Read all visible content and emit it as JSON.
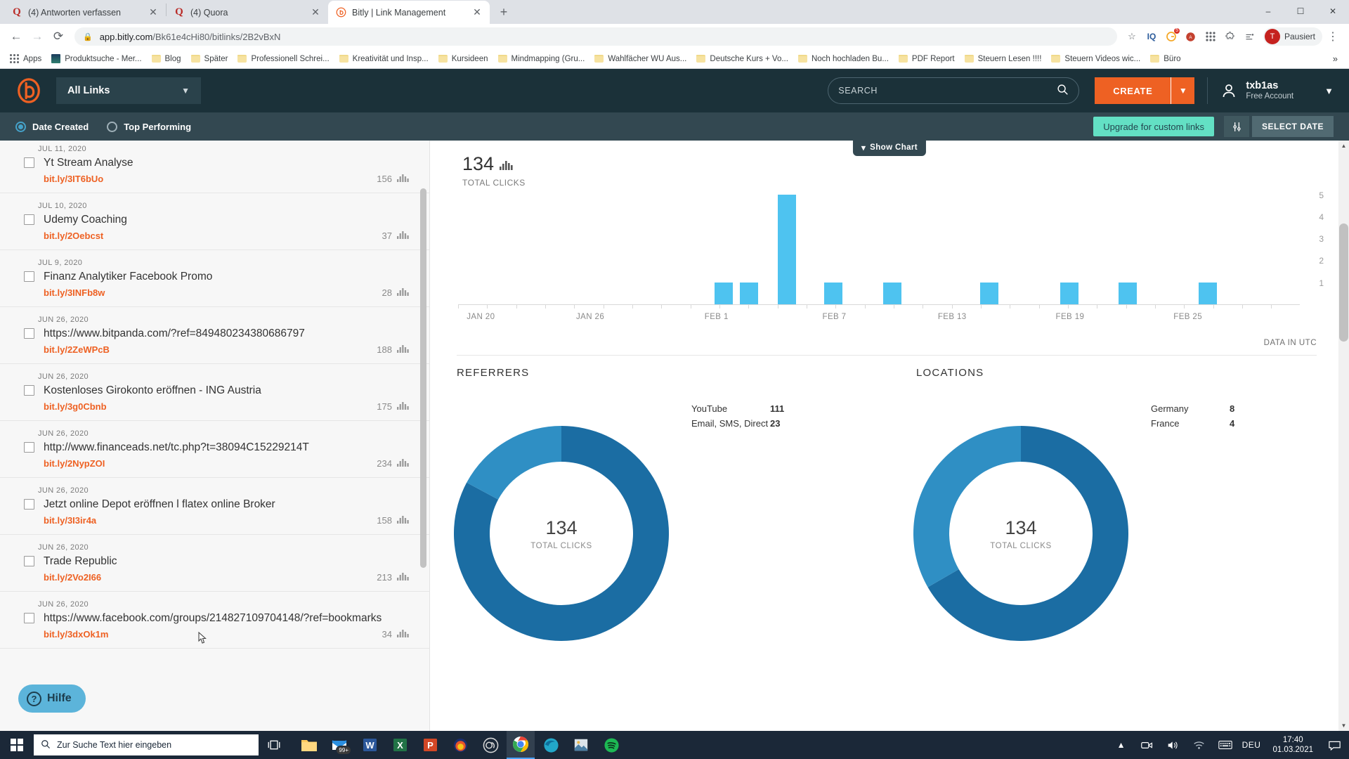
{
  "browser": {
    "tabs": [
      {
        "title": "(4) Antworten verfassen",
        "favicon": "quora-icon",
        "active": false
      },
      {
        "title": "(4) Quora",
        "favicon": "quora-icon",
        "active": false
      },
      {
        "title": "Bitly | Link Management",
        "favicon": "bitly-icon",
        "active": true
      }
    ],
    "new_tab_label": "+",
    "window_controls": {
      "minimize": "–",
      "maximize": "☐",
      "close": "✕"
    },
    "nav": {
      "back": "←",
      "forward": "→",
      "reload": "⟳"
    },
    "omnibox": {
      "lock_icon": "lock-icon",
      "url_host": "app.bitly.com",
      "url_path": "/Bk61e4cHi80/bitlinks/2B2vBxN",
      "star_icon": "bookmark-star-icon"
    },
    "toolbar_icons": [
      "iq-extension-icon",
      "extension-puzzle-icon",
      "grammarly-icon",
      "apps-grid-icon",
      "extensions-icon",
      "list-icon"
    ],
    "profile": {
      "initial": "T",
      "label": "Pausiert"
    },
    "bookmarks": [
      {
        "label": "Apps",
        "icon": "apps-grid-icon"
      },
      {
        "label": "Produktsuche - Mer...",
        "icon": "site-favicon"
      },
      {
        "label": "Blog",
        "icon": "folder-icon"
      },
      {
        "label": "Später",
        "icon": "folder-icon"
      },
      {
        "label": "Professionell Schrei...",
        "icon": "folder-icon"
      },
      {
        "label": "Kreativität und Insp...",
        "icon": "folder-icon"
      },
      {
        "label": "Kursideen",
        "icon": "folder-icon"
      },
      {
        "label": "Mindmapping  (Gru...",
        "icon": "folder-icon"
      },
      {
        "label": "Wahlfächer WU Aus...",
        "icon": "folder-icon"
      },
      {
        "label": "Deutsche Kurs + Vo...",
        "icon": "folder-icon"
      },
      {
        "label": "Noch hochladen Bu...",
        "icon": "folder-icon"
      },
      {
        "label": "PDF Report",
        "icon": "folder-icon"
      },
      {
        "label": "Steuern Lesen !!!!",
        "icon": "folder-icon"
      },
      {
        "label": "Steuern Videos wic...",
        "icon": "folder-icon"
      },
      {
        "label": "Büro",
        "icon": "folder-icon"
      }
    ],
    "bookmarks_overflow": "»"
  },
  "app": {
    "header": {
      "logo": "bitly-logo",
      "links_selector": "All Links",
      "search_placeholder": "SEARCH",
      "search_value": "",
      "create_label": "CREATE",
      "account_name": "txb1as",
      "account_type": "Free Account"
    },
    "subbar": {
      "sort_options": [
        {
          "label": "Date Created",
          "selected": true
        },
        {
          "label": "Top Performing",
          "selected": false
        }
      ],
      "upgrade_label": "Upgrade for custom links",
      "filter_icon": "filter-sliders-icon",
      "select_date_label": "SELECT DATE"
    },
    "links": [
      {
        "date": "JUL 11, 2020",
        "title": "Yt Stream Analyse",
        "short_url": "bit.ly/3IT6bUo",
        "clicks": "156"
      },
      {
        "date": "JUL 10, 2020",
        "title": "Udemy Coaching",
        "short_url": "bit.ly/2Oebcst",
        "clicks": "37"
      },
      {
        "date": "JUL 9, 2020",
        "title": "Finanz Analytiker Facebook Promo",
        "short_url": "bit.ly/3INFb8w",
        "clicks": "28"
      },
      {
        "date": "JUN 26, 2020",
        "title": "https://www.bitpanda.com/?ref=849480234380686797",
        "short_url": "bit.ly/2ZeWPcB",
        "clicks": "188"
      },
      {
        "date": "JUN 26, 2020",
        "title": "Kostenloses Girokonto eröffnen - ING Austria",
        "short_url": "bit.ly/3g0Cbnb",
        "clicks": "175"
      },
      {
        "date": "JUN 26, 2020",
        "title": "http://www.financeads.net/tc.php?t=38094C15229214T",
        "short_url": "bit.ly/2NypZOI",
        "clicks": "234"
      },
      {
        "date": "JUN 26, 2020",
        "title": "Jetzt online Depot eröffnen l flatex online Broker",
        "short_url": "bit.ly/3I3ir4a",
        "clicks": "158"
      },
      {
        "date": "JUN 26, 2020",
        "title": "Trade Republic",
        "short_url": "bit.ly/2Vo2I66",
        "clicks": "213"
      },
      {
        "date": "JUN 26, 2020",
        "title": "https://www.facebook.com/groups/214827109704148/?ref=bookmarks",
        "short_url": "bit.ly/3dxOk1m",
        "clicks": "34"
      }
    ],
    "analytics": {
      "show_chart_label": "Show Chart",
      "total_clicks_value": "134",
      "total_clicks_label": "TOTAL CLICKS",
      "data_utc_label": "DATA IN UTC",
      "referrers": {
        "title": "REFERRERS",
        "center_value": "134",
        "center_label": "TOTAL CLICKS",
        "rows": [
          {
            "name": "YouTube",
            "value": "111"
          },
          {
            "name": "Email, SMS, Direct",
            "value": "23"
          }
        ]
      },
      "locations": {
        "title": "LOCATIONS",
        "center_value": "134",
        "center_label": "TOTAL CLICKS",
        "rows": [
          {
            "name": "Germany",
            "value": "8"
          },
          {
            "name": "France",
            "value": "4"
          }
        ]
      }
    },
    "help_label": "Hilfe"
  },
  "chart_data": {
    "type": "bar",
    "title": "TOTAL CLICKS",
    "xlabel": "",
    "ylabel": "",
    "ylim": [
      0,
      5.5
    ],
    "yticks": [
      1,
      2,
      3,
      4,
      5
    ],
    "grid": false,
    "legend": "none",
    "bar_color": "#4ec3f0",
    "x_tick_labels": [
      "JAN 20",
      "JAN 26",
      "FEB 1",
      "FEB 7",
      "FEB 13",
      "FEB 19",
      "FEB 25"
    ],
    "x_tick_positions_pct": [
      1.5,
      14.5,
      29.5,
      43.5,
      57.5,
      71.5,
      85.5
    ],
    "points": [
      {
        "x_pct": 30.5,
        "value": 1
      },
      {
        "x_pct": 33.5,
        "value": 1
      },
      {
        "x_pct": 38.0,
        "value": 5
      },
      {
        "x_pct": 43.5,
        "value": 1
      },
      {
        "x_pct": 50.5,
        "value": 1
      },
      {
        "x_pct": 62.0,
        "value": 1
      },
      {
        "x_pct": 71.5,
        "value": 1
      },
      {
        "x_pct": 78.5,
        "value": 1
      },
      {
        "x_pct": 88.0,
        "value": 1
      }
    ],
    "donuts": [
      {
        "name": "REFERRERS",
        "type": "pie",
        "center_value": 134,
        "labels": [
          "YouTube",
          "Email, SMS, Direct"
        ],
        "values": [
          111,
          23
        ],
        "colors": [
          "#1b6da3",
          "#2f8fc4"
        ]
      },
      {
        "name": "LOCATIONS",
        "type": "pie",
        "center_value": 134,
        "labels": [
          "Germany",
          "France"
        ],
        "values": [
          8,
          4
        ],
        "colors": [
          "#1b6da3",
          "#2f8fc4"
        ]
      }
    ]
  },
  "taskbar": {
    "start_icon": "windows-start-icon",
    "search_placeholder": "Zur Suche Text hier eingeben",
    "task_view_icon": "task-view-icon",
    "apps": [
      {
        "name": "file-explorer-icon",
        "badge": ""
      },
      {
        "name": "mail-icon",
        "badge": "99+"
      },
      {
        "name": "word-icon",
        "badge": ""
      },
      {
        "name": "excel-icon",
        "badge": ""
      },
      {
        "name": "powerpoint-icon",
        "badge": ""
      },
      {
        "name": "firefox-icon",
        "badge": ""
      },
      {
        "name": "obs-icon",
        "badge": ""
      },
      {
        "name": "chrome-icon",
        "badge": ""
      },
      {
        "name": "edge-icon",
        "badge": ""
      },
      {
        "name": "photos-icon",
        "badge": ""
      },
      {
        "name": "spotify-icon",
        "badge": ""
      }
    ],
    "tray": {
      "expand_icon": "chevron-up-icon",
      "camera_icon": "camera-icon",
      "volume_icon": "volume-icon",
      "network_icon": "wifi-icon",
      "keyboard_icon": "keyboard-icon",
      "language": "DEU",
      "time": "17:40",
      "date": "01.03.2021",
      "notification_icon": "notification-icon"
    }
  }
}
